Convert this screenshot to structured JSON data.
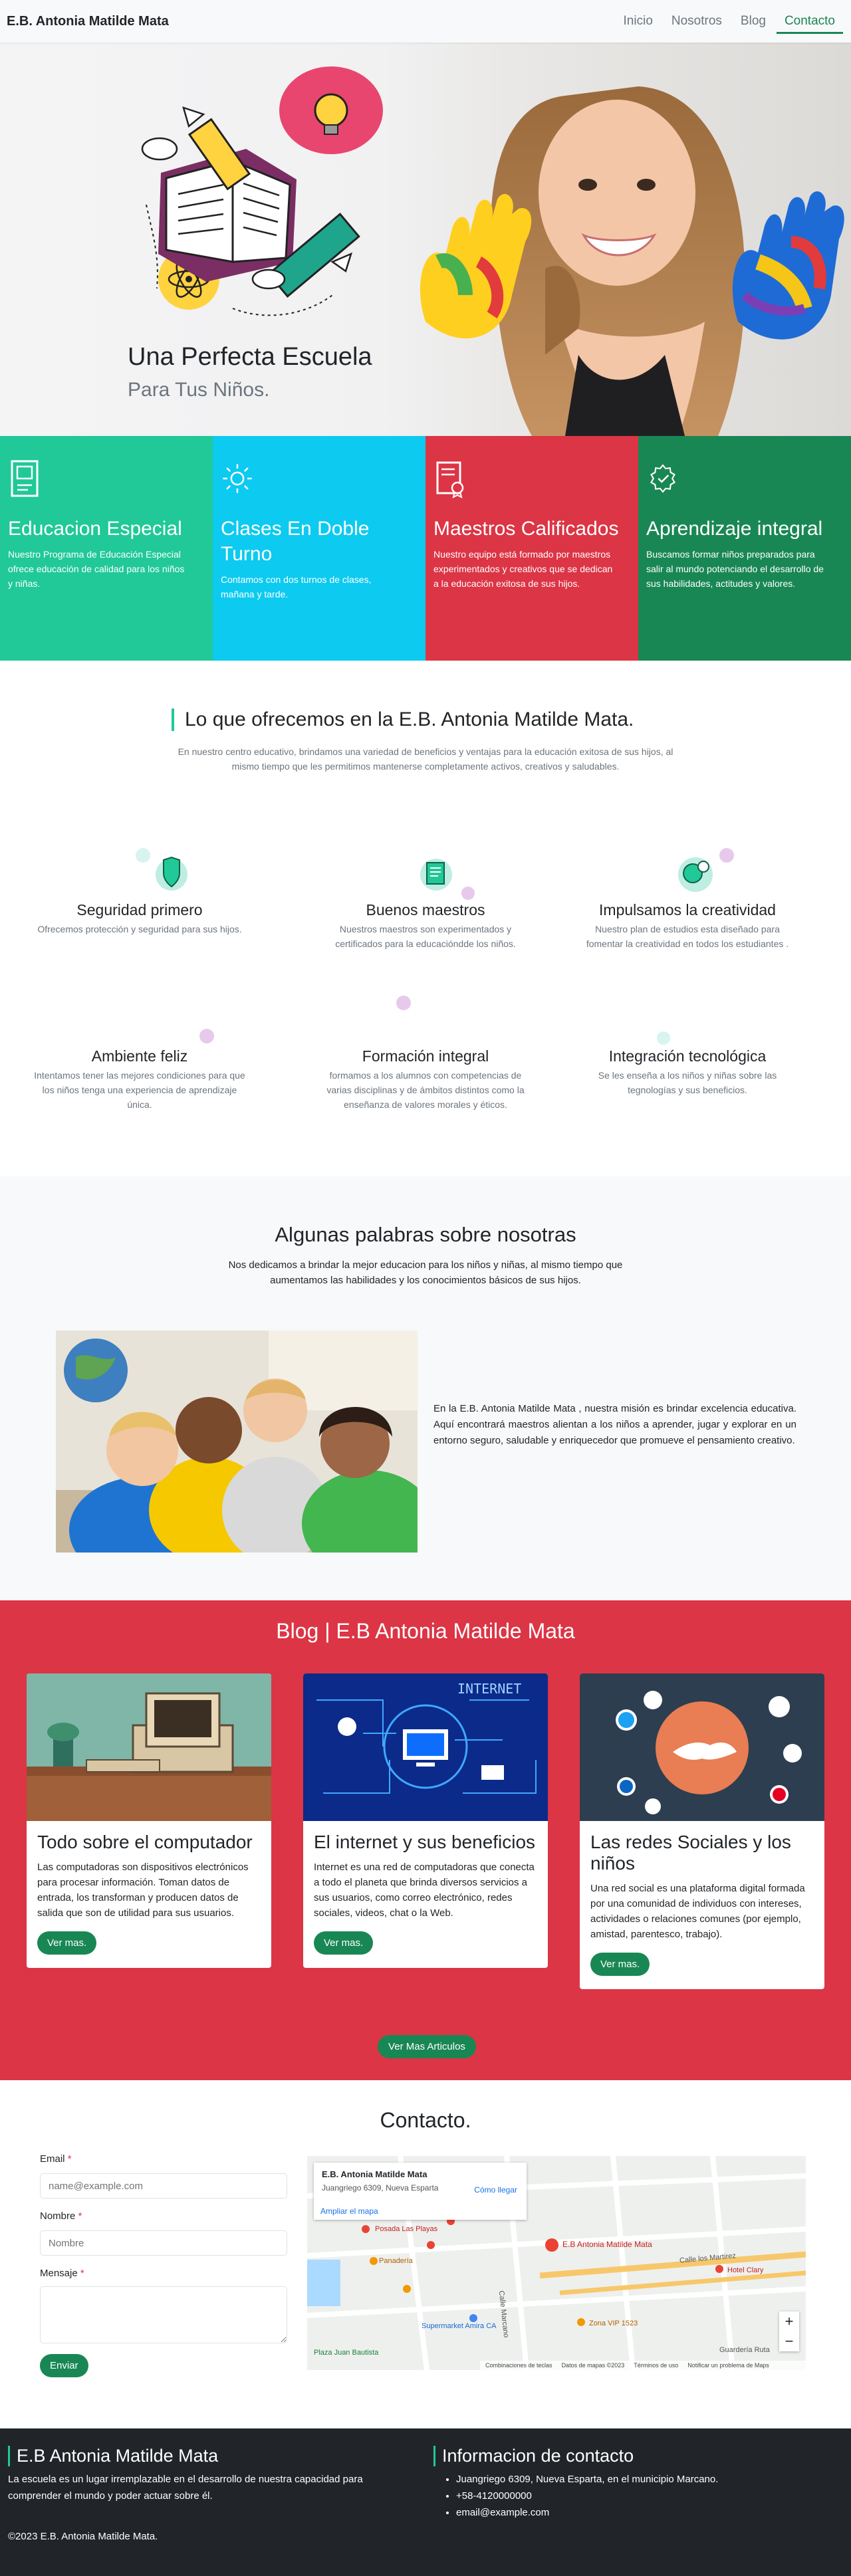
{
  "nav": {
    "brand": "E.B. Antonia Matilde Mata",
    "items": [
      "Inicio",
      "Nosotros",
      "Blog",
      "Contacto"
    ],
    "active": "Contacto"
  },
  "hero": {
    "title": "Una Perfecta Escuela",
    "subtitle": "Para Tus Niños."
  },
  "features": [
    {
      "title": "Educacion Especial",
      "text": "Nuestro Programa de Educación Especial ofrece educación de calidad para los niños y niñas.",
      "color": "#20c997",
      "icon": "book-icon"
    },
    {
      "title": "Clases En Doble Turno",
      "text": "Contamos con dos turnos de clases, mañana y tarde.",
      "color": "#0dcaf0",
      "icon": "sun-icon"
    },
    {
      "title": "Maestros Calificados",
      "text": "Nuestro equipo está formado por maestros experimentados y creativos que se dedican a la educación exitosa de sus hijos.",
      "color": "#dc3545",
      "icon": "certificate-icon"
    },
    {
      "title": "Aprendizaje integral",
      "text": "Buscamos formar niños preparados para salir al mundo potenciando el desarrollo de sus habilidades, actitudes y valores.",
      "color": "#198754",
      "icon": "award-icon"
    }
  ],
  "offer": {
    "title": "Lo que ofrecemos en la E.B. Antonia Matilde Mata.",
    "description": "En nuestro centro educativo, brindamos una variedad de beneficios y ventajas para la educación exitosa de sus hijos, al mismo tiempo que les permitimos mantenerse completamente activos, creativos y saludables.",
    "items": [
      {
        "title": "Seguridad primero",
        "text": "Ofrecemos protección y seguridad para sus hijos."
      },
      {
        "title": "Buenos maestros",
        "text": "Nuestros maestros son experimentados y certificados para la educacióndde los niños."
      },
      {
        "title": "Impulsamos la creatividad",
        "text": "Nuestro plan de estudios esta diseñado para fomentar la creatividad en todos los estudiantes ."
      },
      {
        "title": "Ambiente feliz",
        "text": "Intentamos tener las mejores condiciones para que los niños tenga una experiencia de aprendizaje única."
      },
      {
        "title": "Formación integral",
        "text": "formamos a los alumnos con competencias de varias disciplinas y de ámbitos distintos como la enseñanza de valores morales y éticos."
      },
      {
        "title": "Integración tecnológica",
        "text": "Se les enseña a los niños y niñas sobre las tegnologías y sus beneficios."
      }
    ]
  },
  "about": {
    "title": "Algunas palabras sobre nosotras",
    "description": "Nos dedicamos a brindar la mejor educacion para los niños y niñas, al mismo tiempo que aumentamos las habilidades y los conocimientos básicos de sus hijos.",
    "text": "En la E.B. Antonia Matilde Mata , nuestra misión es brindar excelencia educativa. Aquí encontrará maestros alientan a los niños a aprender, jugar y explorar en un entorno seguro, saludable y enriquecedor que promueve el pensamiento creativo."
  },
  "blog": {
    "title": "Blog | E.B Antonia Matilde Mata",
    "posts": [
      {
        "title": "Todo sobre el computador",
        "text": "Las computadoras son dispositivos electrónicos para procesar información. Toman datos de entrada, los transforman y producen datos de salida que son de utilidad para sus usuarios.",
        "button": "Ver mas."
      },
      {
        "title": "El internet y sus beneficios",
        "text": "Internet es una red de computadoras que conecta a todo el planeta que brinda diversos servicios a sus usuarios, como correo electrónico, redes sociales, videos, chat o la Web.",
        "button": "Ver mas."
      },
      {
        "title": "Las redes Sociales y los niños",
        "text": "Una red social es una plataforma digital formada por una comunidad de individuos con intereses, actividades o relaciones comunes (por ejemplo, amistad, parentesco, trabajo).",
        "button": "Ver mas."
      }
    ],
    "more_button": "Ver Mas Articulos",
    "image_text": "INTERNET"
  },
  "contact": {
    "title": "Contacto.",
    "email_label": "Email",
    "email_placeholder": "name@example.com",
    "name_label": "Nombre",
    "name_placeholder": "Nombre",
    "message_label": "Mensaje",
    "required": "*",
    "submit": "Enviar"
  },
  "map": {
    "place_name": "E.B. Antonia Matilde Mata",
    "address": "Juangriego 6309, Nueva Esparta",
    "directions": "Cómo llegar",
    "enlarge": "Ampliar el mapa",
    "labels": [
      "E.B Antonia Matilde Mata",
      "Posada Las Playas",
      "Panadería",
      "Hotel Clary",
      "Supermarket Amira CA",
      "Zona VIP 1523",
      "Calle los Martirez",
      "Calle Marcano",
      "Plaza Juan Bautista",
      "Guardería Ruta"
    ],
    "zoom_in": "+",
    "zoom_out": "−",
    "attribution": [
      "Combinaciones de teclas",
      "Datos de mapas ©2023",
      "Términos de uso",
      "Notificar un problema de Maps"
    ]
  },
  "footer": {
    "title": "E.B Antonia Matilde Mata",
    "text": "La escuela es un lugar irremplazable en el desarrollo de nuestra capacidad para comprender el mundo y poder actuar sobre él.",
    "contact_title": "Informacion de contacto",
    "contact_items": [
      "Juangriego 6309, Nueva Esparta, en el municipio Marcano.",
      "+58-4120000000",
      "email@example.com"
    ],
    "copyright": "©2023 E.B. Antonia Matilde Mata."
  }
}
